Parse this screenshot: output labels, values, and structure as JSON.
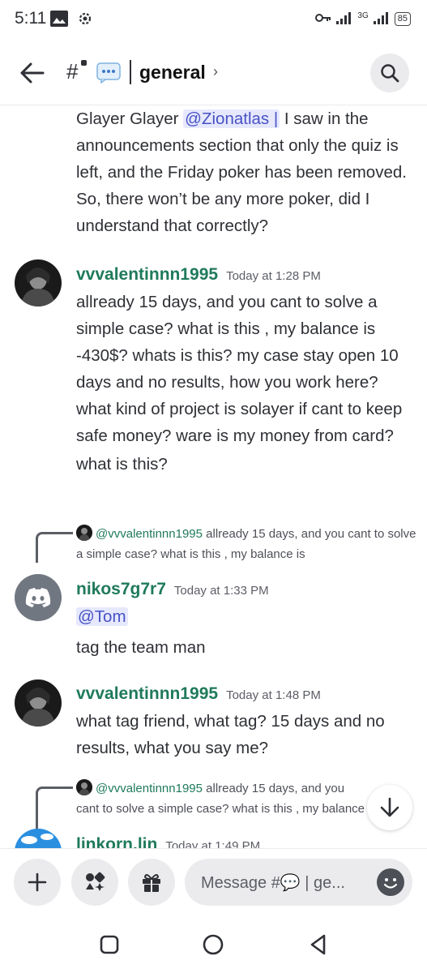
{
  "status_bar": {
    "time": "5:11",
    "network": "3G",
    "battery": "85"
  },
  "header": {
    "channel_name": "general",
    "chevron": "›",
    "hash": "#"
  },
  "messages": [
    {
      "id": "m0",
      "continued": true,
      "mention": "@Zionatlas |",
      "prefix": "Glayer Glayer ",
      "text": " I saw in the announcements section that only the quiz is left, and the Friday poker has been removed. So, there won’t be any more poker, did I understand that correctly?"
    },
    {
      "id": "m1",
      "username": "vvvalentinnn1995",
      "timestamp": "Today at 1:28 PM",
      "lines": [
        "allready 15 days, and you cant to solve a simple case? what is this , my balance is -430$? whats is this? my case stay open 10 days and no results, how you work here? what kind of project is solayer if cant to  keep safe money? ware is my money from card?",
        "what is this?"
      ]
    },
    {
      "id": "m2",
      "reply_user": "@vvvalentinnn1995",
      "reply_text": " allready 15 days, and you cant to solve a simple case? what is this , my balance is",
      "username": "nikos7g7r7",
      "timestamp": "Today at 1:33 PM",
      "mention": "@Tom",
      "text": "tag the team man"
    },
    {
      "id": "m3",
      "username": "vvvalentinnn1995",
      "timestamp": "Today at 1:48 PM",
      "text": "what tag friend, what tag?  15 days and no results, what you say me?"
    },
    {
      "id": "m4",
      "reply_user": "@vvvalentinnn1995",
      "reply_text": " allready 15 days, and you cant to solve a simple case? what is this , my balance",
      "username": "linkorn.lin",
      "timestamp": "Today at 1:49 PM"
    }
  ],
  "composer": {
    "placeholder": "Message #💬 | ge..."
  },
  "icons": {
    "back": "arrow-left-icon",
    "search": "search-icon",
    "add": "plus-icon",
    "apps": "apps-icon",
    "gift": "gift-icon",
    "emoji": "emoji-icon",
    "scroll_down": "arrow-down-icon"
  },
  "colors": {
    "username": "#1f7a5a",
    "mention_bg": "#e6e8fd",
    "mention_fg": "#4752c4",
    "discord_blurple": "#5865f2",
    "discord_default_avatar": "#707781"
  }
}
